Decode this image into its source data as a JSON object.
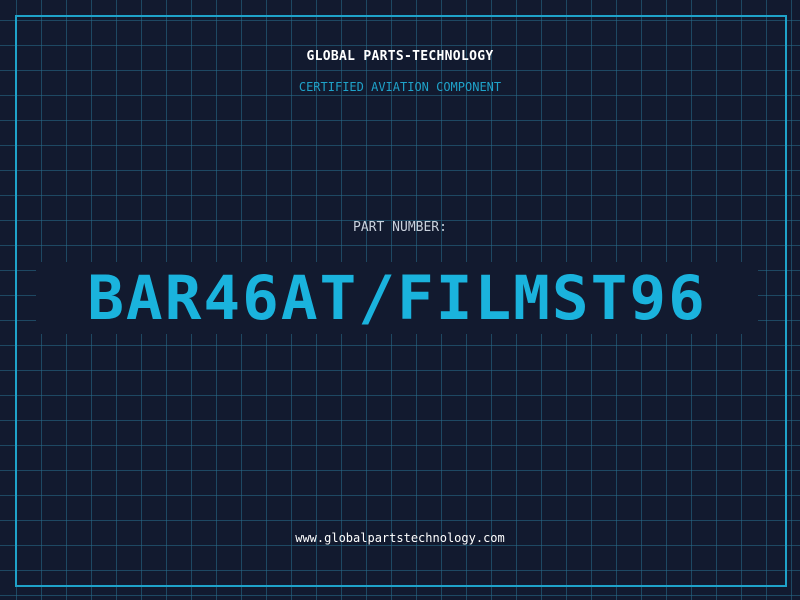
{
  "header": {
    "company": "GLOBAL PARTS-TECHNOLOGY",
    "subtitle": "CERTIFIED AVIATION COMPONENT"
  },
  "part": {
    "label": "PART NUMBER:",
    "number": "BAR46AT/FILMST96"
  },
  "footer": {
    "website": "www.globalpartstechnology.com"
  },
  "colors": {
    "background": "#121a2f",
    "grid": "#286e8c",
    "accent": "#1fa2c9",
    "part_number": "#1ab3dd",
    "text": "#ffffff"
  }
}
